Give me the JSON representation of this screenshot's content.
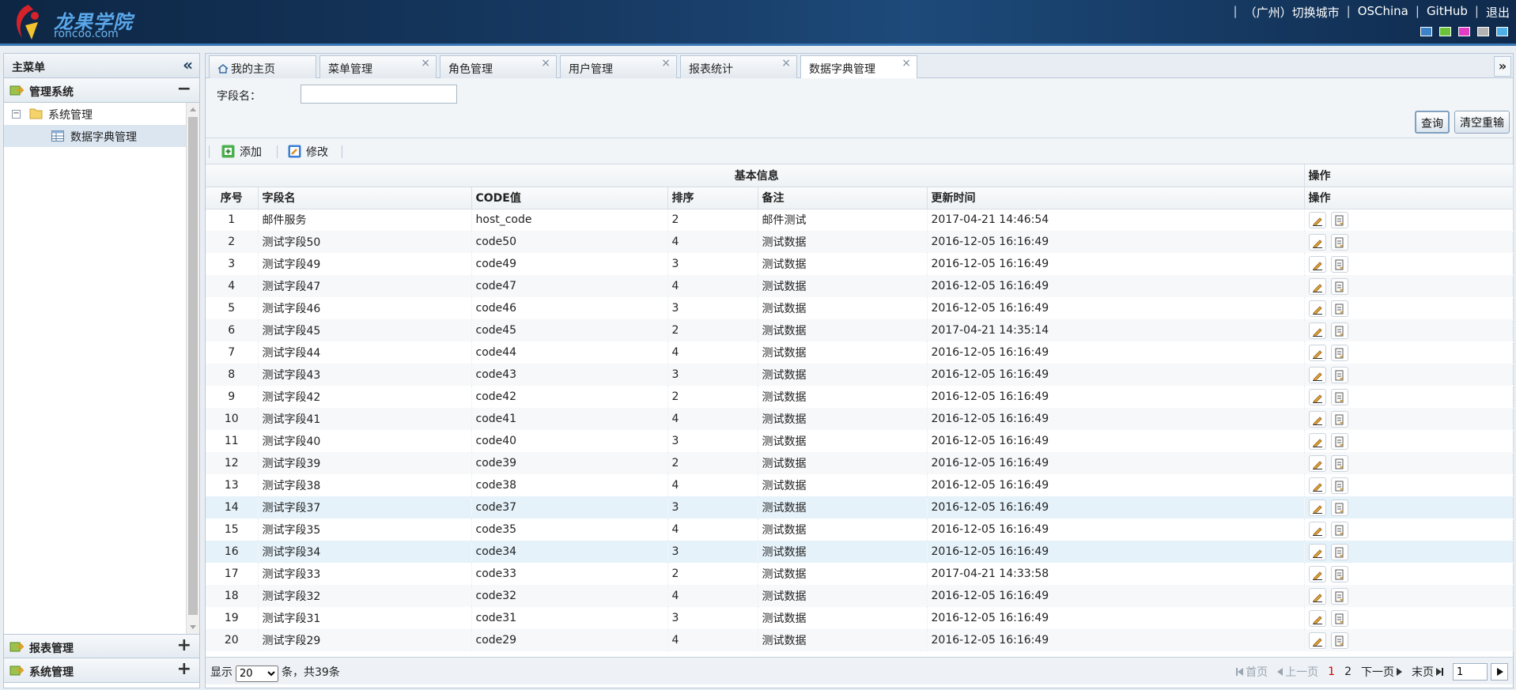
{
  "brand": {
    "name_cn": "龙果学院",
    "domain": "roncoo.com"
  },
  "top_links": [
    "（广州）切换城市",
    "OSChina",
    "GitHub",
    "退出"
  ],
  "theme_colors": [
    "#3b82c8",
    "#6ac23b",
    "#e23dc4",
    "#b3b3b3",
    "#4fb0e8"
  ],
  "sidebar": {
    "title": "主菜单",
    "accordion": [
      {
        "label": "管理系统",
        "toggle": "−"
      },
      {
        "label": "报表管理",
        "toggle": "+"
      },
      {
        "label": "系统管理",
        "toggle": "+"
      }
    ],
    "tree": {
      "folder": "系统管理",
      "item": "数据字典管理"
    }
  },
  "tabs": [
    {
      "label": "我的主页"
    },
    {
      "label": "菜单管理"
    },
    {
      "label": "角色管理"
    },
    {
      "label": "用户管理"
    },
    {
      "label": "报表统计"
    },
    {
      "label": "数据字典管理"
    }
  ],
  "search": {
    "field_label": "字段名：",
    "field_value": "",
    "query_button": "查询",
    "reset_button": "清空重输"
  },
  "toolbar": {
    "add": "添加",
    "edit": "修改"
  },
  "table": {
    "group_headers": {
      "basic": "基本信息",
      "ops": "操作"
    },
    "columns": {
      "seq": "序号",
      "field": "字段名",
      "code": "CODE值",
      "sort": "排序",
      "remark": "备注",
      "updated": "更新时间",
      "ops": "操作"
    },
    "rows": [
      {
        "seq": "1",
        "field": "邮件服务",
        "code": "host_code",
        "sort": "2",
        "remark": "邮件测试",
        "updated": "2017-04-21 14:46:54"
      },
      {
        "seq": "2",
        "field": "测试字段50",
        "code": "code50",
        "sort": "4",
        "remark": "测试数据",
        "updated": "2016-12-05 16:16:49"
      },
      {
        "seq": "3",
        "field": "测试字段49",
        "code": "code49",
        "sort": "3",
        "remark": "测试数据",
        "updated": "2016-12-05 16:16:49"
      },
      {
        "seq": "4",
        "field": "测试字段47",
        "code": "code47",
        "sort": "4",
        "remark": "测试数据",
        "updated": "2016-12-05 16:16:49"
      },
      {
        "seq": "5",
        "field": "测试字段46",
        "code": "code46",
        "sort": "3",
        "remark": "测试数据",
        "updated": "2016-12-05 16:16:49"
      },
      {
        "seq": "6",
        "field": "测试字段45",
        "code": "code45",
        "sort": "2",
        "remark": "测试数据",
        "updated": "2017-04-21 14:35:14"
      },
      {
        "seq": "7",
        "field": "测试字段44",
        "code": "code44",
        "sort": "4",
        "remark": "测试数据",
        "updated": "2016-12-05 16:16:49"
      },
      {
        "seq": "8",
        "field": "测试字段43",
        "code": "code43",
        "sort": "3",
        "remark": "测试数据",
        "updated": "2016-12-05 16:16:49"
      },
      {
        "seq": "9",
        "field": "测试字段42",
        "code": "code42",
        "sort": "2",
        "remark": "测试数据",
        "updated": "2016-12-05 16:16:49"
      },
      {
        "seq": "10",
        "field": "测试字段41",
        "code": "code41",
        "sort": "4",
        "remark": "测试数据",
        "updated": "2016-12-05 16:16:49"
      },
      {
        "seq": "11",
        "field": "测试字段40",
        "code": "code40",
        "sort": "3",
        "remark": "测试数据",
        "updated": "2016-12-05 16:16:49"
      },
      {
        "seq": "12",
        "field": "测试字段39",
        "code": "code39",
        "sort": "2",
        "remark": "测试数据",
        "updated": "2016-12-05 16:16:49"
      },
      {
        "seq": "13",
        "field": "测试字段38",
        "code": "code38",
        "sort": "4",
        "remark": "测试数据",
        "updated": "2016-12-05 16:16:49"
      },
      {
        "seq": "14",
        "field": "测试字段37",
        "code": "code37",
        "sort": "3",
        "remark": "测试数据",
        "updated": "2016-12-05 16:16:49"
      },
      {
        "seq": "15",
        "field": "测试字段35",
        "code": "code35",
        "sort": "4",
        "remark": "测试数据",
        "updated": "2016-12-05 16:16:49"
      },
      {
        "seq": "16",
        "field": "测试字段34",
        "code": "code34",
        "sort": "3",
        "remark": "测试数据",
        "updated": "2016-12-05 16:16:49"
      },
      {
        "seq": "17",
        "field": "测试字段33",
        "code": "code33",
        "sort": "2",
        "remark": "测试数据",
        "updated": "2017-04-21 14:33:58"
      },
      {
        "seq": "18",
        "field": "测试字段32",
        "code": "code32",
        "sort": "4",
        "remark": "测试数据",
        "updated": "2016-12-05 16:16:49"
      },
      {
        "seq": "19",
        "field": "测试字段31",
        "code": "code31",
        "sort": "3",
        "remark": "测试数据",
        "updated": "2016-12-05 16:16:49"
      },
      {
        "seq": "20",
        "field": "测试字段29",
        "code": "code29",
        "sort": "4",
        "remark": "测试数据",
        "updated": "2016-12-05 16:16:49"
      }
    ]
  },
  "pager": {
    "show_label": "显示",
    "page_size": "20",
    "total_text": "条，共39条",
    "first": "首页",
    "prev": "上一页",
    "pages": [
      "1",
      "2"
    ],
    "next": "下一页",
    "last": "末页",
    "page_input": "1"
  }
}
